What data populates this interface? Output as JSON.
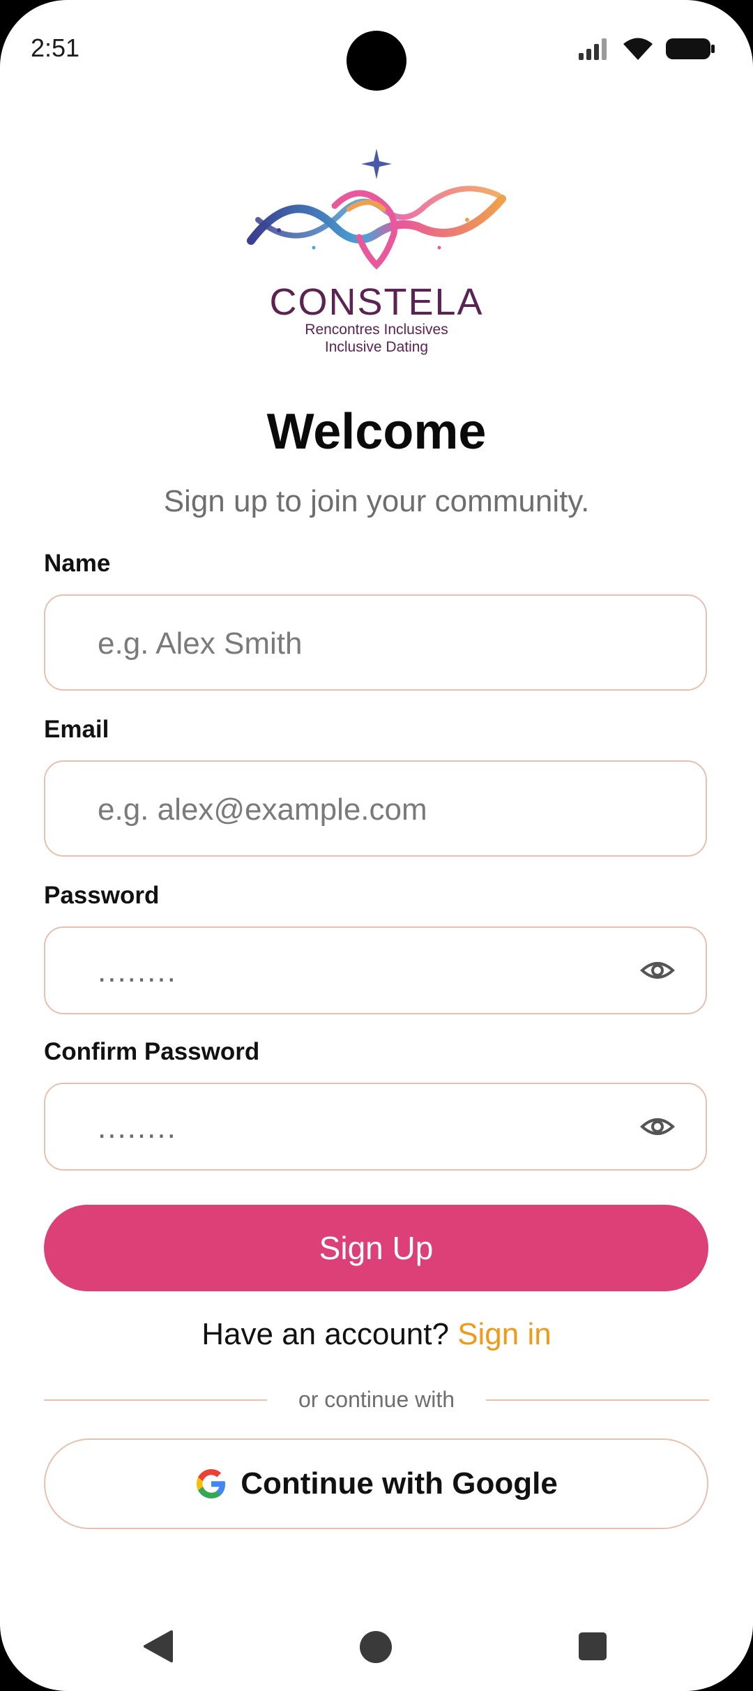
{
  "status_bar": {
    "time": "2:51"
  },
  "logo": {
    "title": "CONSTELA",
    "subtitle_fr": "Rencontres Inclusives",
    "subtitle_en": "Inclusive Dating"
  },
  "header": {
    "title": "Welcome",
    "subtitle": "Sign up to join your community."
  },
  "form": {
    "name": {
      "label": "Name",
      "placeholder": "e.g. Alex Smith"
    },
    "email": {
      "label": "Email",
      "placeholder": "e.g. alex@example.com"
    },
    "password": {
      "label": "Password",
      "placeholder": "........"
    },
    "confirm_password": {
      "label": "Confirm Password",
      "placeholder": "........"
    },
    "submit_label": "Sign Up"
  },
  "signin": {
    "prompt": "Have an account?",
    "link": "Sign in"
  },
  "divider": {
    "text": "or continue with"
  },
  "google": {
    "label": "Continue with Google"
  },
  "colors": {
    "accent": "#dd4077",
    "link": "#f09a1a",
    "field_border": "#e9bfae",
    "logo_text": "#5b2352"
  },
  "icons": [
    "signal-icon",
    "wifi-icon",
    "battery-icon",
    "eye-icon",
    "google-icon",
    "back-icon",
    "home-icon",
    "recents-icon"
  ]
}
